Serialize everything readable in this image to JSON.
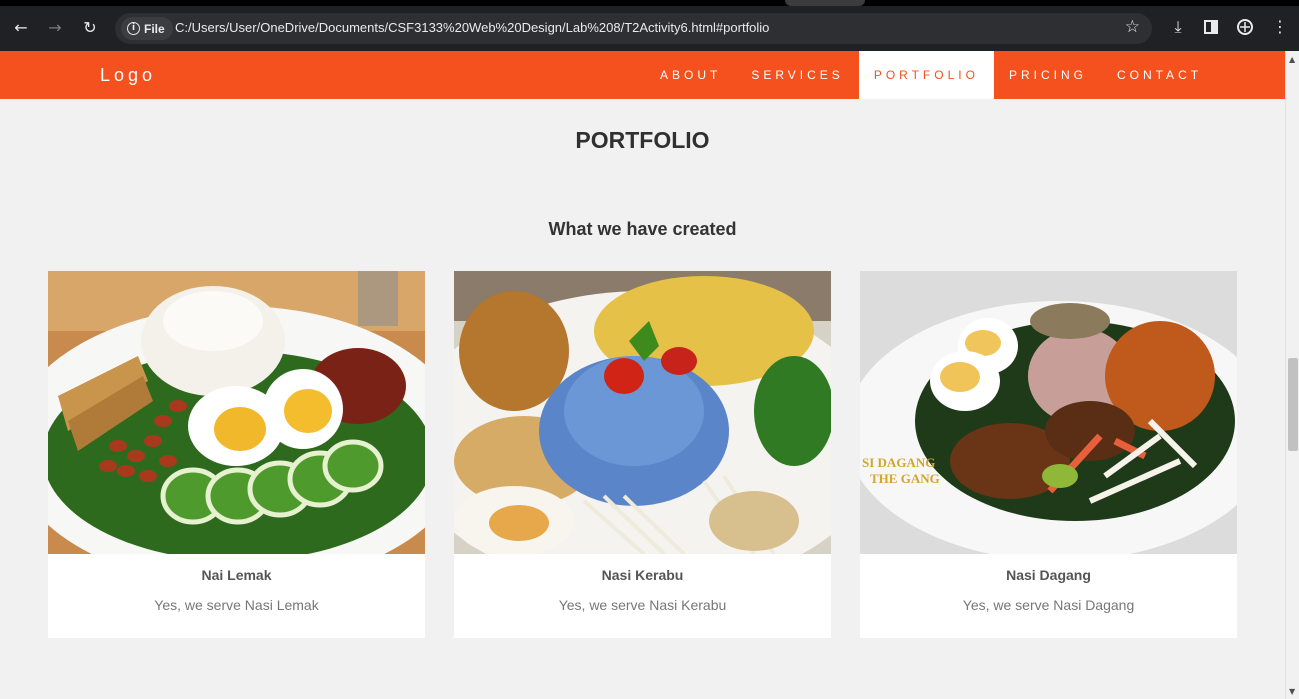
{
  "browser": {
    "site_chip_label": "File",
    "url": "C:/Users/User/OneDrive/Documents/CSF3133%20Web%20Design/Lab%208/T2Activity6.html#portfolio",
    "back_icon": "arrow-left-icon",
    "forward_icon": "arrow-right-icon",
    "reload_icon": "reload-icon",
    "bookmark_icon": "star-icon",
    "download_icon": "download-icon",
    "menu_icon": "kebab-menu-icon"
  },
  "navbar": {
    "logo": "Logo",
    "links": [
      "ABOUT",
      "SERVICES",
      "PORTFOLIO",
      "PRICING",
      "CONTACT"
    ],
    "active_link": "PORTFOLIO",
    "bg_color": "#f4511e"
  },
  "section": {
    "title": "PORTFOLIO",
    "subtitle": "What we have created"
  },
  "cards": [
    {
      "title": "Nai Lemak",
      "desc": "Yes, we serve Nasi Lemak"
    },
    {
      "title": "Nasi Kerabu",
      "desc": "Yes, we serve Nasi Kerabu"
    },
    {
      "title": "Nasi Dagang",
      "desc": "Yes, we serve Nasi Dagang"
    }
  ],
  "image_watermark": {
    "line1": "SI DAGANG",
    "line2": "THE GANG"
  }
}
